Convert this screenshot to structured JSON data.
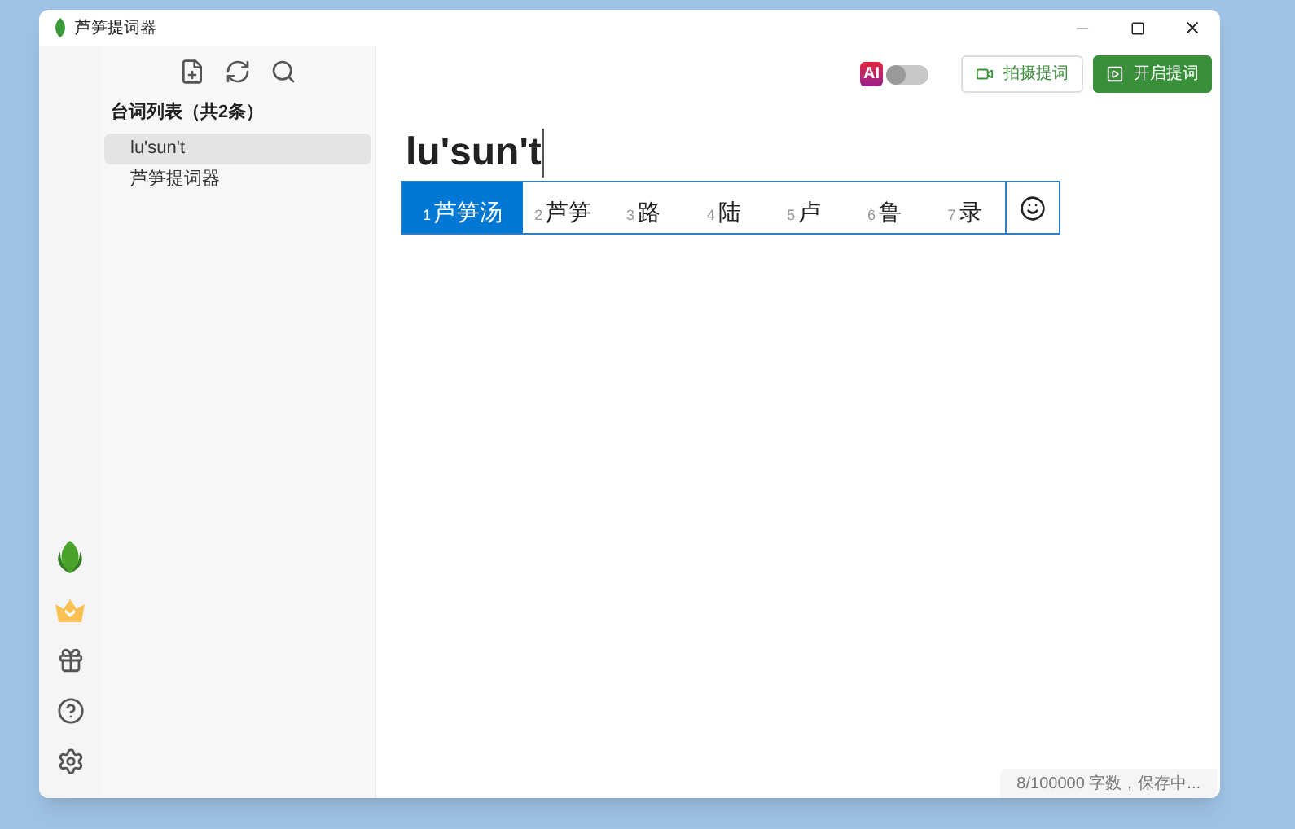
{
  "window": {
    "title": "芦笋提词器"
  },
  "sidebar": {
    "heading": "台词列表（共2条）",
    "items": [
      {
        "label": "lu'sun't",
        "selected": true
      },
      {
        "label": "芦笋提词器",
        "selected": false
      }
    ]
  },
  "toolbar": {
    "ai_badge": "AI",
    "ai_on": false,
    "buttons": [
      {
        "label": "拍摄提词",
        "kind": "outline"
      },
      {
        "label": "开启提词",
        "kind": "primary"
      }
    ]
  },
  "editor": {
    "value": "lu'sun't"
  },
  "ime": {
    "candidates": [
      {
        "index": "1",
        "text": "芦笋汤",
        "selected": true
      },
      {
        "index": "2",
        "text": "芦笋",
        "selected": false
      },
      {
        "index": "3",
        "text": "路",
        "selected": false
      },
      {
        "index": "4",
        "text": "陆",
        "selected": false
      },
      {
        "index": "5",
        "text": "卢",
        "selected": false
      },
      {
        "index": "6",
        "text": "鲁",
        "selected": false
      },
      {
        "index": "7",
        "text": "录",
        "selected": false
      }
    ]
  },
  "status_bar": "8/100000 字数，保存中..."
}
